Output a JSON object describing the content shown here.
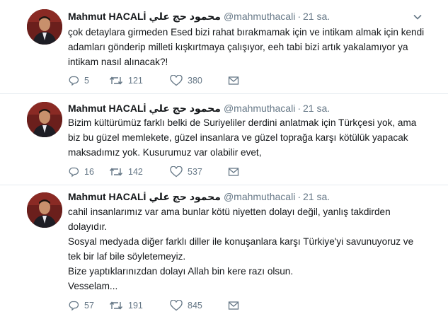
{
  "tweets": [
    {
      "name": "Mahmut HACALİ",
      "name_arabic": "محمود حج علي",
      "handle": "@mahmuthacali",
      "separator": "·",
      "time": "21 sa.",
      "text": [
        "çok detaylara girmeden Esed bizi rahat bırakmamak için ve intikam almak için kendi adamları gönderip milleti kışkırtmaya çalışıyor, eeh tabi bizi artık yakalamıyor ya intikam nasıl alınacak?!"
      ],
      "replies": "5",
      "retweets": "121",
      "likes": "380"
    },
    {
      "name": "Mahmut HACALİ",
      "name_arabic": "محمود حج علي",
      "handle": "@mahmuthacali",
      "separator": "·",
      "time": "21 sa.",
      "text": [
        "Bizim kültürümüz farklı belki de Suriyeliler derdini anlatmak için Türkçesi yok, ama biz bu güzel memlekete, güzel insanlara ve güzel toprağa karşı kötülük yapacak maksadımız yok. Kusurumuz var olabilir evet,"
      ],
      "replies": "16",
      "retweets": "142",
      "likes": "537"
    },
    {
      "name": "Mahmut HACALİ",
      "name_arabic": "محمود حج علي",
      "handle": "@mahmuthacali",
      "separator": "·",
      "time": "21 sa.",
      "text": [
        "cahil insanlarımız var ama bunlar kötü niyetten dolayı değil, yanlış takdirden dolayıdır.",
        "Sosyal medyada diğer farklı diller ile konuşanlara karşı Türkiye'yi savunuyoruz ve tek bir laf bile söyletemeyiz.",
        "Bize yaptıklarınızdan dolayı Allah bin kere razı olsun.",
        "Vesselam..."
      ],
      "replies": "57",
      "retweets": "191",
      "likes": "845"
    }
  ],
  "icons": {
    "caret": "chevron-down-icon",
    "reply": "reply-icon",
    "retweet": "retweet-icon",
    "like": "heart-icon",
    "dm": "envelope-icon"
  },
  "colors": {
    "text": "#14171a",
    "secondary": "#657786",
    "divider": "#e6ecf0"
  }
}
